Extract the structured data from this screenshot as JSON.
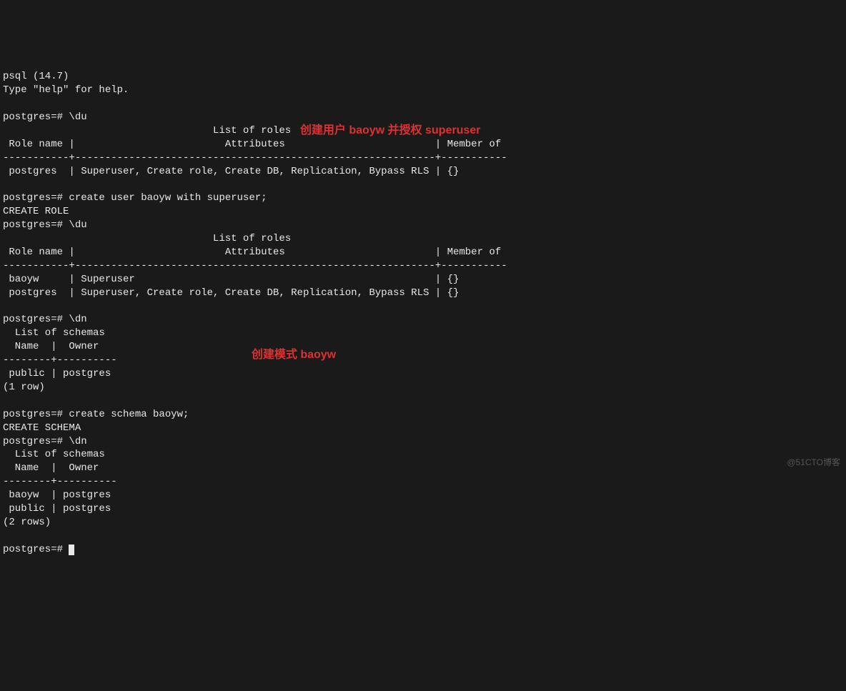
{
  "header": {
    "version_line": "psql (14.7)",
    "help_line": "Type \"help\" for help."
  },
  "block1": {
    "prompt": "postgres=# \\du",
    "title": "                                   List of roles",
    "col_header": " Role name |                         Attributes                         | Member of ",
    "sep": "-----------+------------------------------------------------------------+-----------",
    "row1": " postgres  | Superuser, Create role, Create DB, Replication, Bypass RLS | {}"
  },
  "block2": {
    "prompt": "postgres=# create user baoyw with superuser;",
    "result": "CREATE ROLE"
  },
  "block3": {
    "prompt": "postgres=# \\du",
    "title": "                                   List of roles",
    "col_header": " Role name |                         Attributes                         | Member of ",
    "sep": "-----------+------------------------------------------------------------+-----------",
    "row1": " baoyw     | Superuser                                                  | {}",
    "row2": " postgres  | Superuser, Create role, Create DB, Replication, Bypass RLS | {}"
  },
  "block4": {
    "prompt": "postgres=# \\dn",
    "title": "  List of schemas",
    "header": "  Name  |  Owner   ",
    "sep": "--------+----------",
    "row1": " public | postgres",
    "count": "(1 row)"
  },
  "block5": {
    "prompt": "postgres=# create schema baoyw;",
    "result": "CREATE SCHEMA"
  },
  "block6": {
    "prompt": "postgres=# \\dn",
    "title": "  List of schemas",
    "header": "  Name  |  Owner   ",
    "sep": "--------+----------",
    "row1": " baoyw  | postgres",
    "row2": " public | postgres",
    "count": "(2 rows)"
  },
  "final_prompt": "postgres=# ",
  "annotations": {
    "a1": "创建用户 baoyw 并授权 superuser",
    "a2": "创建模式 baoyw"
  },
  "watermark": "@51CTO博客"
}
